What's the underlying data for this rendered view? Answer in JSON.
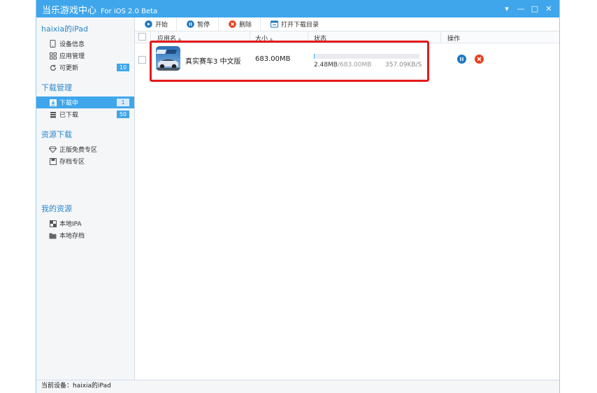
{
  "window": {
    "title": "当乐游戏中心",
    "subtitle": "For iOS 2.0 Beta",
    "controls": {
      "menu": "▾",
      "minimize": "—",
      "maximize": "□",
      "close": "✕"
    }
  },
  "sidebar": {
    "device_name": "haixia的iPad",
    "device_items": [
      {
        "label": "设备信息",
        "icon": "tablet-icon"
      },
      {
        "label": "应用管理",
        "icon": "grid-icon"
      },
      {
        "label": "可更新",
        "icon": "refresh-icon",
        "badge": "10"
      }
    ],
    "download_section": "下载管理",
    "download_items": [
      {
        "label": "下载中",
        "icon": "download-icon",
        "badge": "1",
        "active": true
      },
      {
        "label": "已下载",
        "icon": "stack-icon",
        "badge": "50"
      }
    ],
    "resource_section": "资源下载",
    "resource_items": [
      {
        "label": "正版免费专区",
        "icon": "diamond-icon"
      },
      {
        "label": "存档专区",
        "icon": "save-icon"
      }
    ],
    "my_section": "我的资源",
    "my_items": [
      {
        "label": "本地IPA",
        "icon": "ipa-icon"
      },
      {
        "label": "本地存档",
        "icon": "folder-icon"
      }
    ]
  },
  "toolbar": {
    "start_label": "开始",
    "pause_label": "暂停",
    "delete_label": "删除",
    "open_dir_label": "打开下载目录"
  },
  "table": {
    "columns": [
      "应用名",
      "大小",
      "状态",
      "操作"
    ],
    "rows": [
      {
        "name": "真实赛车3 中文版",
        "size": "683.00MB",
        "downloaded": "2.48MB",
        "total": "/683.00MB",
        "speed": "357.09KB/S",
        "progress_percent": 0.4
      }
    ]
  },
  "status_bar": {
    "current_device": "当前设备：haixia的iPad"
  },
  "colors": {
    "accent": "#3fa6eb",
    "highlight": "#e51a1a",
    "delete": "#e8401c"
  }
}
